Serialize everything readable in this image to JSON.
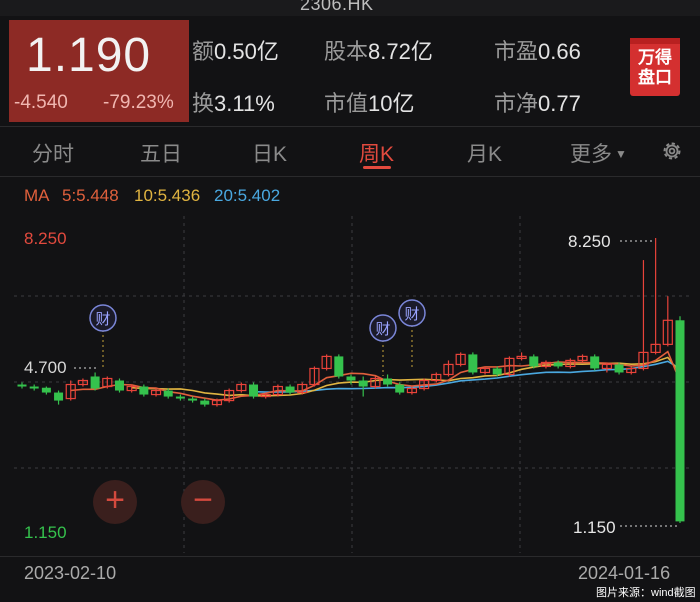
{
  "header": {
    "ticker": "2306.HK"
  },
  "quote": {
    "price": "1.190",
    "change": "-4.540",
    "change_pct": "-79.23%"
  },
  "stats": [
    {
      "key": "额",
      "value": "0.50亿"
    },
    {
      "key": "股本",
      "value": "8.72亿"
    },
    {
      "key": "市盈",
      "value": "0.66"
    },
    {
      "key": "换",
      "value": "3.11%"
    },
    {
      "key": "市值",
      "value": "10亿"
    },
    {
      "key": "市净",
      "value": "0.77"
    }
  ],
  "brand": {
    "line1": "万得",
    "line2": "盘口"
  },
  "tabs": [
    {
      "label": "分时"
    },
    {
      "label": "五日"
    },
    {
      "label": "日K"
    },
    {
      "label": "周K"
    },
    {
      "label": "月K"
    },
    {
      "label": "更多"
    }
  ],
  "active_tab": "周K",
  "ma": {
    "label": "MA",
    "ma5": "5:5.448",
    "ma10": "10:5.436",
    "ma20": "20:5.402"
  },
  "colors": {
    "up": "#e8433a",
    "down": "#35c24d",
    "ma5": "#e0603c",
    "ma10": "#e0b441",
    "ma20": "#4aa8e0",
    "accent": "#e24a3e"
  },
  "chart": {
    "y_top_label": "8.250",
    "y_mid_label": "4.700",
    "y_bottom_label": "1.150",
    "high_label": "8.250",
    "low_label": "1.150",
    "event_marker": "财",
    "zoom_in": "+",
    "zoom_out": "−",
    "start_date": "2023-02-10",
    "end_date": "2024-01-16"
  },
  "credit": "图片来源：wind截图"
}
